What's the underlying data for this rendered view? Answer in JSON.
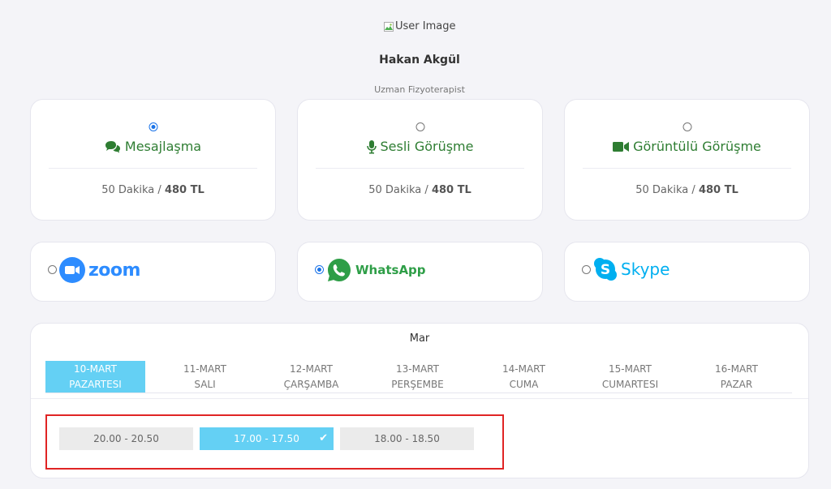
{
  "profile": {
    "image_alt": "User Image",
    "name": "Hakan Akgül",
    "title": "Uzman Fizyoterapist"
  },
  "services": [
    {
      "label": "Mesajlaşma",
      "duration": "50 Dakika",
      "separator": "/",
      "price": "480 TL",
      "selected": true,
      "icon": "chat-icon"
    },
    {
      "label": "Sesli Görüşme",
      "duration": "50 Dakika",
      "separator": "/",
      "price": "480 TL",
      "selected": false,
      "icon": "microphone-icon"
    },
    {
      "label": "Görüntülü Görüşme",
      "duration": "50 Dakika",
      "separator": "/",
      "price": "480 TL",
      "selected": false,
      "icon": "video-camera-icon"
    }
  ],
  "apps": [
    {
      "label": "zoom",
      "selected": false,
      "icon": "zoom-logo-icon"
    },
    {
      "label": "WhatsApp",
      "selected": true,
      "icon": "whatsapp-logo-icon"
    },
    {
      "label": "Skype",
      "selected": false,
      "icon": "skype-logo-icon"
    }
  ],
  "calendar": {
    "month": "Mar",
    "days": [
      {
        "date": "10-MART",
        "weekday": "PAZARTESI",
        "active": true
      },
      {
        "date": "11-MART",
        "weekday": "SALI",
        "active": false
      },
      {
        "date": "12-MART",
        "weekday": "ÇARŞAMBA",
        "active": false
      },
      {
        "date": "13-MART",
        "weekday": "PERŞEMBE",
        "active": false
      },
      {
        "date": "14-MART",
        "weekday": "CUMA",
        "active": false
      },
      {
        "date": "15-MART",
        "weekday": "CUMARTESI",
        "active": false
      },
      {
        "date": "16-MART",
        "weekday": "PAZAR",
        "active": false
      }
    ],
    "slots": [
      {
        "time": "20.00 - 20.50",
        "selected": false
      },
      {
        "time": "17.00 - 17.50",
        "selected": true
      },
      {
        "time": "18.00 - 18.50",
        "selected": false
      }
    ]
  },
  "colors": {
    "accent": "#64d0f4",
    "service_green": "#2e7d32",
    "highlight_red": "#e02424"
  }
}
